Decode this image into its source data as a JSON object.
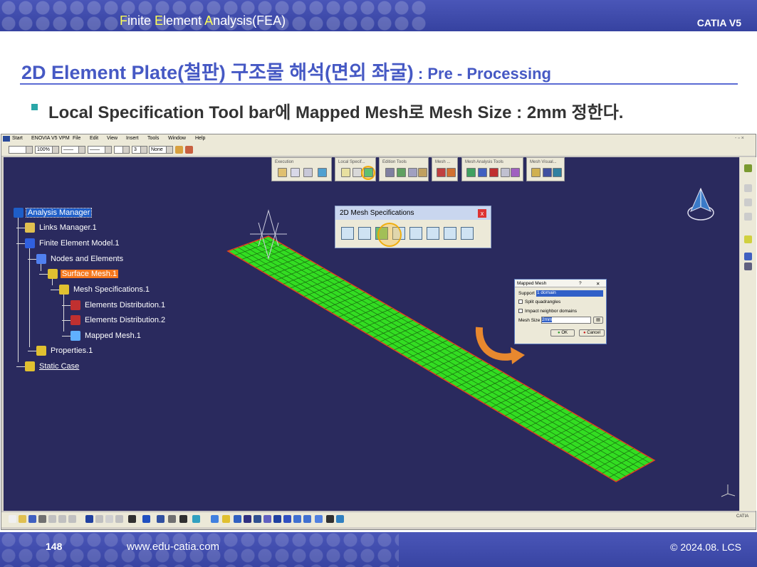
{
  "header": {
    "title_parts": [
      {
        "t": "F",
        "hl": true
      },
      {
        "t": "inite ",
        "hl": false
      },
      {
        "t": "E",
        "hl": true
      },
      {
        "t": "lement ",
        "hl": false
      },
      {
        "t": "A",
        "hl": true
      },
      {
        "t": "nalysis(FEA)",
        "hl": false
      }
    ],
    "brand": "CATIA V5"
  },
  "slide": {
    "title_main": "2D Element Plate(철판) 구조물 해석(면외 좌굴)",
    "title_sub": " : Pre - Processing",
    "instruction_parts": [
      "Local Specification Tool bar",
      "에 ",
      "Mapped Mesh",
      "로 ",
      "Mesh Size : 2mm",
      " 정한다."
    ]
  },
  "catia": {
    "menu": [
      "Start",
      "ENOVIA V5 VPM",
      "File",
      "Edit",
      "View",
      "Insert",
      "Tools",
      "Window",
      "Help"
    ],
    "combos": [
      "",
      "100%",
      "——",
      "——",
      "",
      "3",
      "None"
    ],
    "toolbars": [
      {
        "label": "Execution"
      },
      {
        "label": "Local Specif..."
      },
      {
        "label": "Edition Tools"
      },
      {
        "label": "Mesh ..."
      },
      {
        "label": "Mesh Analysis Tools"
      },
      {
        "label": "Mesh Visual..."
      }
    ],
    "tree": [
      {
        "label": "Analysis Manager",
        "icon": "analysis-manager-icon",
        "selected": "blue"
      },
      {
        "label": "Links Manager.1",
        "icon": "links-manager-icon"
      },
      {
        "label": "Finite Element Model.1",
        "icon": "fem-icon"
      },
      {
        "label": "Nodes and Elements",
        "icon": "nodes-elements-icon"
      },
      {
        "label": "Surface Mesh.1",
        "icon": "surface-mesh-icon",
        "selected": "orange"
      },
      {
        "label": "Mesh Specifications.1",
        "icon": "mesh-spec-icon"
      },
      {
        "label": "Elements Distribution.1",
        "icon": "elements-distribution-icon"
      },
      {
        "label": "Elements Distribution.2",
        "icon": "elements-distribution-icon"
      },
      {
        "label": "Mapped Mesh.1",
        "icon": "mapped-mesh-icon"
      },
      {
        "label": "Properties.1",
        "icon": "properties-icon"
      },
      {
        "label": "Static Case",
        "icon": "static-case-icon",
        "underline": true
      }
    ],
    "mesh_spec_panel": {
      "title": "2D Mesh Specifications",
      "close": "x",
      "tools": [
        "quad-mesh-icon",
        "free-mesh-icon",
        "mapped-mesh-icon",
        "triangle-mesh-icon",
        "boundary-icon",
        "tri-icon",
        "beam-icon",
        "beam2-icon"
      ]
    },
    "mapped_mesh_dialog": {
      "title": "Mapped Mesh",
      "help": "?",
      "close": "✕",
      "support_label": "Support",
      "support_value": "1 domain",
      "split_label": "Split quadrangles",
      "impact_label": "Impact neighbor domains",
      "size_label": "Mesh Size",
      "size_value": "2mm",
      "ok": "OK",
      "cancel": "Cancel"
    },
    "plate": {
      "rows": 8,
      "cols": 56,
      "color": "#33dd22"
    }
  },
  "footer": {
    "page": "148",
    "url": "www.edu-catia.com",
    "copyright": "© 2024.08. LCS"
  }
}
